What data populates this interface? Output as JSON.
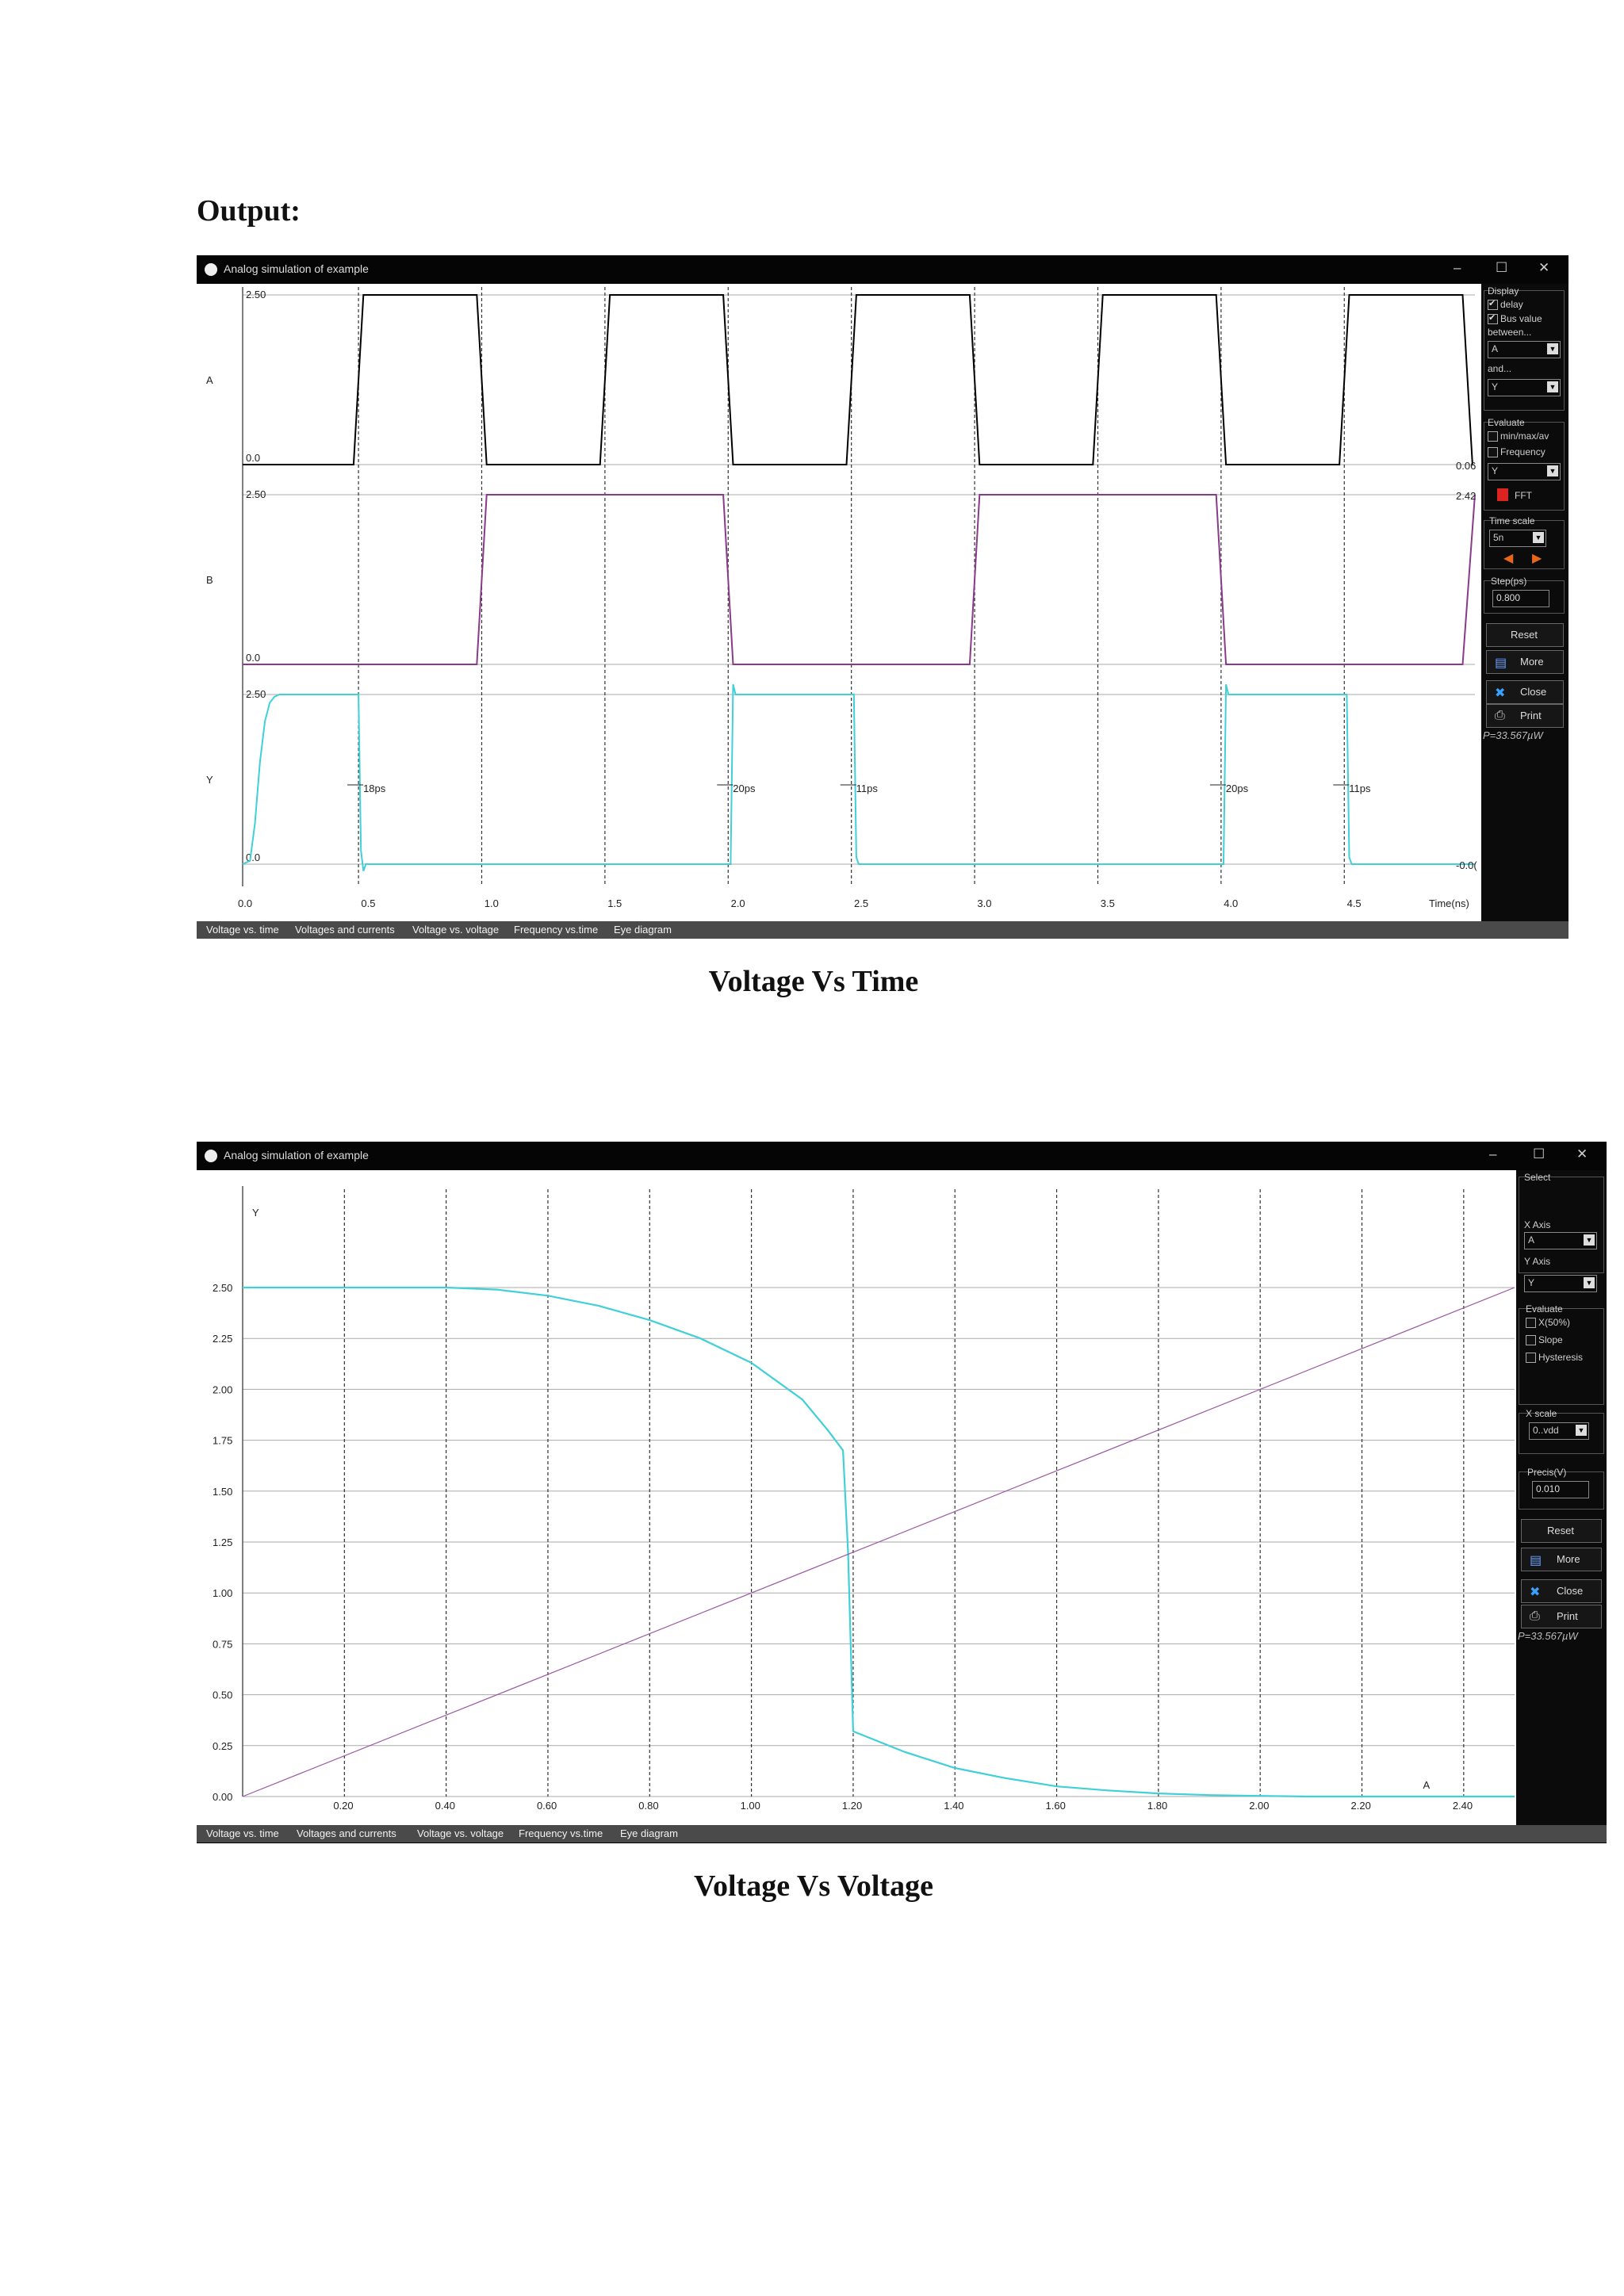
{
  "page": {
    "heading": "Output:",
    "caption_1": "Voltage Vs Time",
    "caption_2": "Voltage Vs Voltage"
  },
  "window1": {
    "title": "Analog simulation of example",
    "controls": {
      "minimize": "–",
      "maximize": "☐",
      "close": "✕"
    },
    "signals": [
      "A",
      "B",
      "Y"
    ],
    "y_labels": [
      "2.50",
      "0.0"
    ],
    "x_ticks": [
      "0.0",
      "0.5",
      "1.0",
      "1.5",
      "2.0",
      "2.5",
      "3.0",
      "3.5",
      "4.0",
      "4.5"
    ],
    "x_axis_label": "Time(ns)",
    "delay_labels": [
      "18ps",
      "20ps",
      "11ps",
      "20ps",
      "11ps"
    ],
    "edge_values": [
      "0.06",
      "2.42",
      "-0.0("
    ],
    "panel": {
      "display_label": "Display",
      "delay_label": "delay",
      "delay_checked": true,
      "bus_label": "Bus value",
      "bus_checked": true,
      "between_label": "between...",
      "between_value": "A",
      "and_label": "and...",
      "and_value": "Y",
      "evaluate_label": "Evaluate",
      "minmax_label": "min/max/av",
      "frequency_label": "Frequency",
      "eval_value": "Y",
      "fft_label": "FFT",
      "timescale_label": "Time scale",
      "timescale_value": "5n",
      "step_label": "Step(ps)",
      "step_value": "0.800",
      "reset_label": "Reset",
      "more_label": "More",
      "close_label": "Close",
      "print_label": "Print",
      "power": "P=33.567µW"
    },
    "tabs": [
      "Voltage vs. time",
      "Voltages and currents",
      "Voltage vs. voltage",
      "Frequency vs.time",
      "Eye diagram"
    ],
    "colors": {
      "A": "#000000",
      "B": "#8a3a8a",
      "Y": "#40d0d8",
      "grid": "#333333"
    }
  },
  "window2": {
    "title": "Analog simulation of example",
    "controls": {
      "minimize": "–",
      "maximize": "☐",
      "close": "✕"
    },
    "y_axis_label": "Y",
    "x_axis_label": "A",
    "panel": {
      "select_label": "Select",
      "xaxis_label": "X Axis",
      "xaxis_value": "A",
      "yaxis_label": "Y Axis",
      "yaxis_value": "Y",
      "evaluate_label": "Evaluate",
      "x50_label": "X(50%)",
      "slope_label": "Slope",
      "hysteresis_label": "Hysteresis",
      "xscale_label": "X scale",
      "xscale_value": "0..vdd",
      "precis_label": "Precis(V)",
      "precis_value": "0.010",
      "reset_label": "Reset",
      "more_label": "More",
      "close_label": "Close",
      "print_label": "Print",
      "power": "P=33.567µW"
    },
    "tabs": [
      "Voltage vs. time",
      "Voltages and currents",
      "Voltage vs. voltage",
      "Frequency vs.time",
      "Eye diagram"
    ]
  },
  "chart_data": [
    {
      "type": "line",
      "title": "",
      "xlabel": "Time(ns)",
      "ylabel": "",
      "xlim": [
        0,
        5
      ],
      "x_ticks": [
        0.0,
        0.5,
        1.0,
        1.5,
        2.0,
        2.5,
        3.0,
        3.5,
        4.0,
        4.5
      ],
      "series": [
        {
          "name": "A",
          "ylim": [
            0,
            2.5
          ],
          "x": [
            0,
            0.45,
            0.49,
            0.95,
            0.99,
            1.45,
            1.49,
            1.95,
            1.99,
            2.45,
            2.49,
            2.95,
            2.99,
            3.45,
            3.49,
            3.95,
            3.99,
            4.45,
            4.49,
            4.95,
            4.99
          ],
          "y": [
            0,
            0,
            2.5,
            2.5,
            0,
            0,
            2.5,
            2.5,
            0,
            0,
            2.5,
            2.5,
            0,
            0,
            2.5,
            2.5,
            0,
            0,
            2.5,
            2.5,
            0
          ]
        },
        {
          "name": "B",
          "ylim": [
            0,
            2.5
          ],
          "x": [
            0,
            0.95,
            0.99,
            1.95,
            1.99,
            2.95,
            2.99,
            3.95,
            3.99,
            4.95,
            5.0
          ],
          "y": [
            0,
            0,
            2.5,
            2.5,
            0,
            0,
            2.5,
            2.5,
            0,
            0,
            2.5
          ]
        },
        {
          "name": "Y",
          "ylim": [
            0,
            2.5
          ],
          "x": [
            0,
            0.03,
            0.05,
            0.07,
            0.09,
            0.11,
            0.13,
            0.15,
            0.2,
            0.47,
            0.48,
            0.49,
            0.5,
            1.98,
            1.99,
            2.0,
            2.48,
            2.49,
            2.5,
            3.98,
            3.99,
            4.0,
            4.48,
            4.49,
            4.5,
            5.0
          ],
          "y": [
            0,
            0.05,
            0.6,
            1.5,
            2.1,
            2.38,
            2.47,
            2.5,
            2.5,
            2.5,
            0.2,
            -0.1,
            0,
            0,
            2.65,
            2.5,
            2.5,
            0.1,
            0,
            0,
            2.65,
            2.5,
            2.5,
            0.1,
            0,
            0
          ]
        }
      ],
      "annotations": [
        "18ps",
        "20ps",
        "11ps",
        "20ps",
        "11ps"
      ],
      "grid": true
    },
    {
      "type": "line",
      "title": "",
      "xlabel": "A",
      "ylabel": "Y",
      "xlim": [
        0,
        2.5
      ],
      "ylim": [
        0,
        2.5
      ],
      "x_ticks": [
        0.2,
        0.4,
        0.6,
        0.8,
        1.0,
        1.2,
        1.4,
        1.6,
        1.8,
        2.0,
        2.2,
        2.4
      ],
      "y_ticks": [
        0.0,
        0.25,
        0.5,
        0.75,
        1.0,
        1.25,
        1.5,
        1.75,
        2.0,
        2.25,
        2.5
      ],
      "series": [
        {
          "name": "Y",
          "x": [
            0,
            0.4,
            0.5,
            0.6,
            0.7,
            0.8,
            0.9,
            1.0,
            1.1,
            1.15,
            1.18,
            1.19,
            1.2,
            1.3,
            1.4,
            1.5,
            1.6,
            1.7,
            1.8,
            1.9,
            2.0,
            2.1,
            2.5
          ],
          "y": [
            2.5,
            2.5,
            2.49,
            2.46,
            2.41,
            2.34,
            2.25,
            2.13,
            1.95,
            1.8,
            1.7,
            1.2,
            0.32,
            0.22,
            0.14,
            0.09,
            0.05,
            0.03,
            0.015,
            0.007,
            0.003,
            0.0,
            0.0
          ]
        },
        {
          "name": "A",
          "x": [
            0,
            2.5
          ],
          "y": [
            0,
            2.5
          ]
        }
      ],
      "grid": true
    }
  ]
}
